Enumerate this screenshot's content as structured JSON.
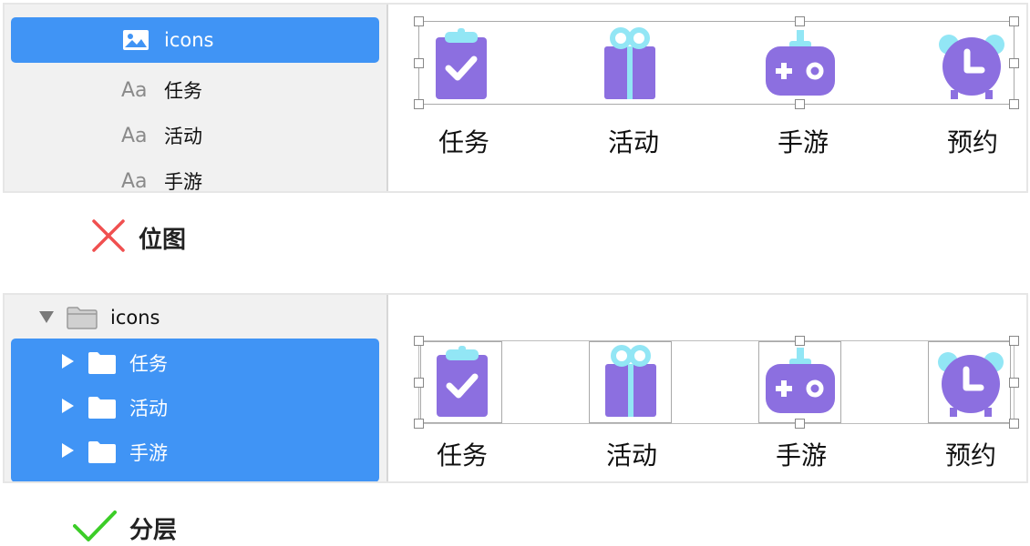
{
  "top_example": {
    "sidebar": {
      "selected_item": {
        "label": "icons",
        "icon": "image-icon"
      },
      "items": [
        {
          "prefix": "Aa",
          "label": "任务"
        },
        {
          "prefix": "Aa",
          "label": "活动"
        },
        {
          "prefix": "Aa",
          "label": "手游"
        }
      ]
    },
    "canvas_labels": [
      "任务",
      "活动",
      "手游",
      "预约"
    ],
    "verdict": {
      "mark": "x-mark-icon",
      "text": "位图",
      "color": "#f05050"
    }
  },
  "bottom_example": {
    "sidebar": {
      "group": {
        "label": "icons",
        "icon": "folder-icon"
      },
      "items": [
        {
          "label": "任务",
          "icon": "folder-icon"
        },
        {
          "label": "活动",
          "icon": "folder-icon"
        },
        {
          "label": "手游",
          "icon": "folder-icon"
        }
      ]
    },
    "canvas_labels": [
      "任务",
      "活动",
      "手游",
      "预约"
    ],
    "verdict": {
      "mark": "check-mark-icon",
      "text": "分层",
      "color": "#3ccd28"
    }
  },
  "colors": {
    "selection": "#4094f5",
    "icon_purple": "#8c6fe0",
    "icon_cyan": "#92e6f5"
  }
}
